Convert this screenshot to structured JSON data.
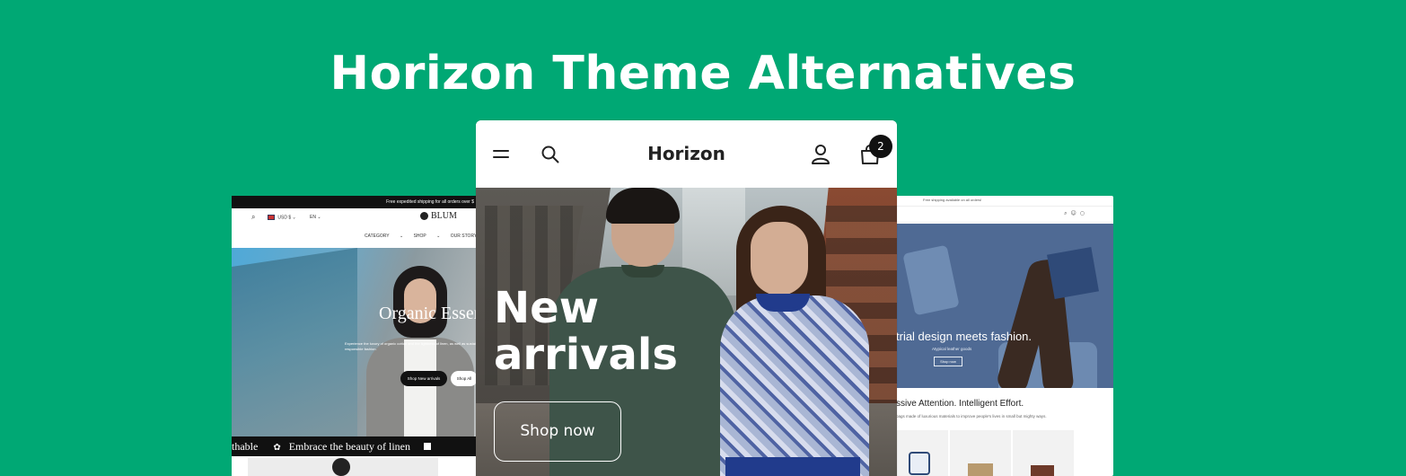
{
  "banner": {
    "title": "Horizon Theme Alternatives",
    "background_color": "#00a874"
  },
  "left_preview": {
    "announcement": "Free expedited shipping for all orders over $",
    "header": {
      "currency": "USD $",
      "language": "EN",
      "logo": "BLUM",
      "nav": [
        "CATEGORY",
        "SHOP",
        "OUR STORY"
      ]
    },
    "hero": {
      "heading": "Organic Essent",
      "subtext": "Experience the luxury of organic cotton and the lightness of linen, as well as sustainable and responsible fashion.",
      "primary_button": "Shop New arrivals",
      "secondary_button": "Shop All"
    },
    "marquee": {
      "left_fragment": "thable",
      "text": "Embrace the beauty of linen"
    }
  },
  "center_preview": {
    "header": {
      "logo": "Horizon",
      "cart_count": "2",
      "icons": [
        "menu-icon",
        "search-icon",
        "account-icon",
        "cart-icon"
      ]
    },
    "hero": {
      "title_line1": "New",
      "title_line2": "arrivals",
      "button": "Shop now"
    }
  },
  "right_preview": {
    "announcement": "Free shipping available on all orders!",
    "hero": {
      "heading": "trial design meets fashion.",
      "subtext": "Atypical leather goods",
      "button": "Shop now"
    },
    "section": {
      "title": "ssive Attention. Intelligent Effort.",
      "subtitle": "bags made of luxurious materials to improve people's lives in small but mighty ways."
    }
  }
}
